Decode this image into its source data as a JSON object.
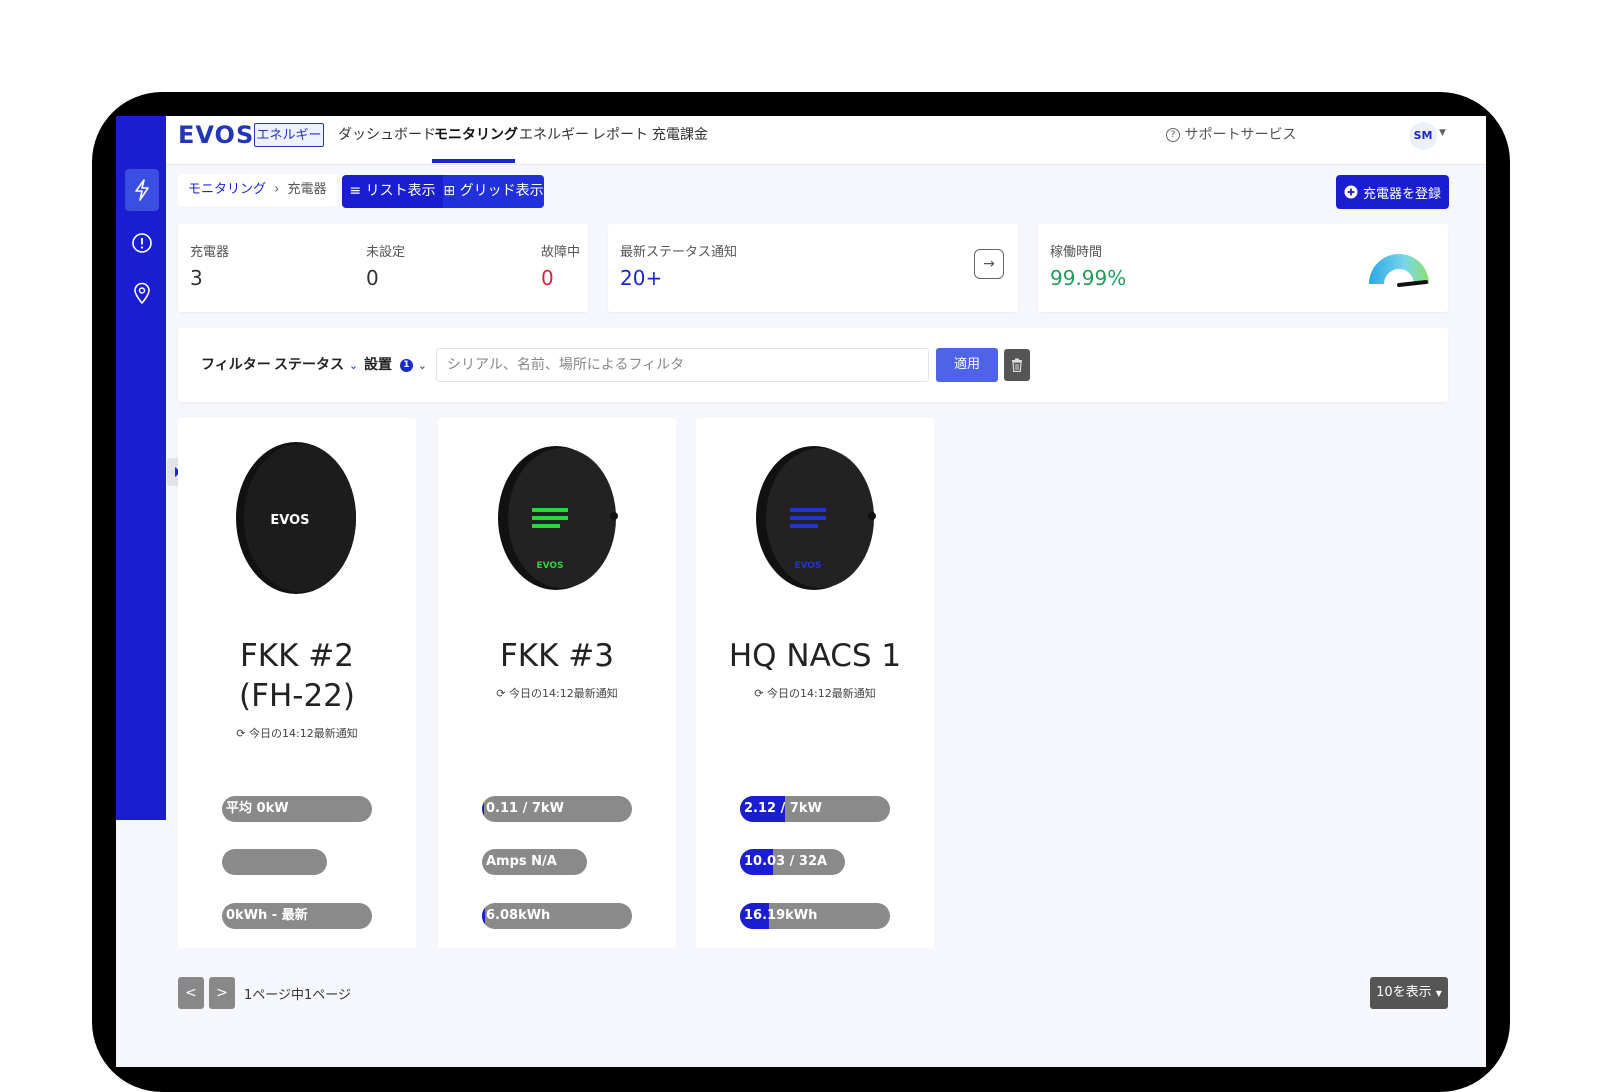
{
  "app": {
    "logo": "EVOS",
    "badge": "エネルギー"
  },
  "nav": {
    "items": [
      {
        "label": "ダッシュボード",
        "active": false
      },
      {
        "label": "モニタリング",
        "active": true
      },
      {
        "label": "エネルギー",
        "active": false
      },
      {
        "label": "レポート",
        "active": false
      },
      {
        "label": "充電課金",
        "active": false
      }
    ],
    "support": "サポートサービス",
    "user_initials": "SM"
  },
  "sidebar": {
    "icons": [
      "bolt-icon",
      "alert-icon",
      "location-pin-icon"
    ]
  },
  "breadcrumb": {
    "parent": "モニタリング",
    "separator": "›",
    "current": "充電器"
  },
  "view_toggle": {
    "list_label": "リスト表示",
    "grid_label": "グリッド表示",
    "list_icon": "≡",
    "grid_icon": "⊞"
  },
  "register_button": "充電器を登録",
  "stats": {
    "chargers_label": "充電器",
    "chargers_value": "3",
    "unset_label": "未設定",
    "unset_value": "0",
    "fault_label": "故障中",
    "fault_value": "0",
    "fault_color": "#d9253a",
    "notify_label": "最新ステータス通知",
    "notify_value": "20+",
    "uptime_label": "稼働時間",
    "uptime_value": "99.99%",
    "uptime_color": "#1e9e5a"
  },
  "filter": {
    "label": "フィルター",
    "status_label": "ステータス",
    "install_label": "設置",
    "install_count": "1",
    "search_placeholder": "シリアル、名前、場所によるフィルタ",
    "apply_label": "適用"
  },
  "chargers": [
    {
      "name_line1": "FKK #2",
      "name_line2": "(FH-22)",
      "updated": "今日の14:12最新通知",
      "accent": "none",
      "pills": [
        {
          "text": "平均 0kW",
          "fill": 0
        },
        {
          "text": "",
          "fill": 0
        },
        {
          "text": "0kWh - 最新",
          "fill": 0
        }
      ]
    },
    {
      "name_line1": "FKK #3",
      "name_line2": "",
      "updated": "今日の14:12最新通知",
      "accent": "#2fd43a",
      "pills": [
        {
          "text": "0.11 / 7kW",
          "fill": 0.016
        },
        {
          "text": "Amps N/A",
          "fill": 0
        },
        {
          "text": "6.08kWh",
          "fill": 0.02
        }
      ]
    },
    {
      "name_line1": "HQ NACS 1",
      "name_line2": "",
      "updated": "今日の14:12最新通知",
      "accent": "#2436c8",
      "pills": [
        {
          "text": "2.12 / 7kW",
          "fill": 0.3
        },
        {
          "text": "10.03 / 32A",
          "fill": 0.31
        },
        {
          "text": "16.19kWh",
          "fill": 0.19
        }
      ]
    }
  ],
  "pagination": {
    "prev": "<",
    "next": ">",
    "text": "1ページ中1ページ",
    "per_page": "10を表示"
  }
}
